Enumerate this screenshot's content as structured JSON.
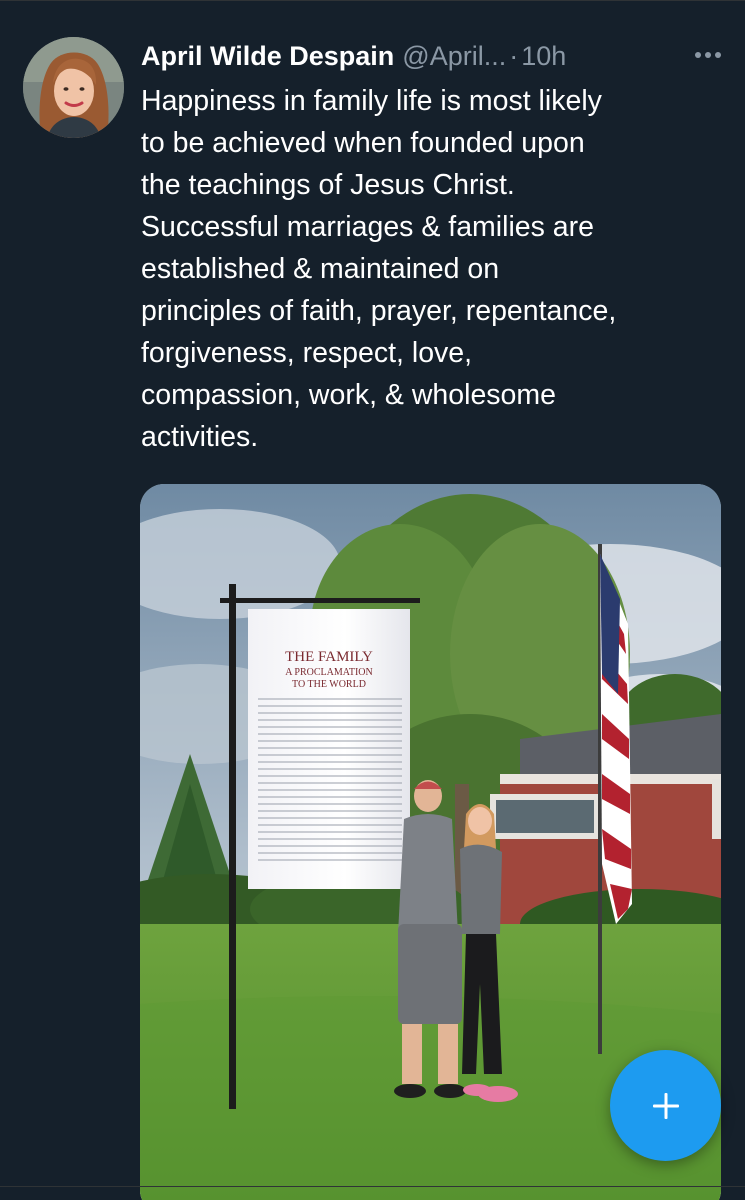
{
  "tweet": {
    "author": {
      "display_name": "April Wilde Despain",
      "handle": "@April...",
      "avatar_icon": "profile-photo"
    },
    "separator": "·",
    "timestamp": "10h",
    "more_icon": "more-horizontal-icon",
    "text": "Happiness in family life is most likely\nto be achieved when founded upon\nthe teachings of Jesus Christ.\nSuccessful marriages & families are\nestablished & maintained on\nprinciples of faith, prayer, repentance,\nforgiveness, respect, love,\ncompassion, work, & wholesome\nactivities.",
    "media": {
      "banner": {
        "title": "THE FAMILY",
        "subtitle_line1": "A PROCLAMATION",
        "subtitle_line2": "TO THE WORLD"
      }
    }
  },
  "compose_button": {
    "icon": "plus-icon"
  },
  "colors": {
    "background": "#15202b",
    "text_primary": "#ffffff",
    "text_secondary": "#8b98a5",
    "accent": "#1d9bf0"
  }
}
